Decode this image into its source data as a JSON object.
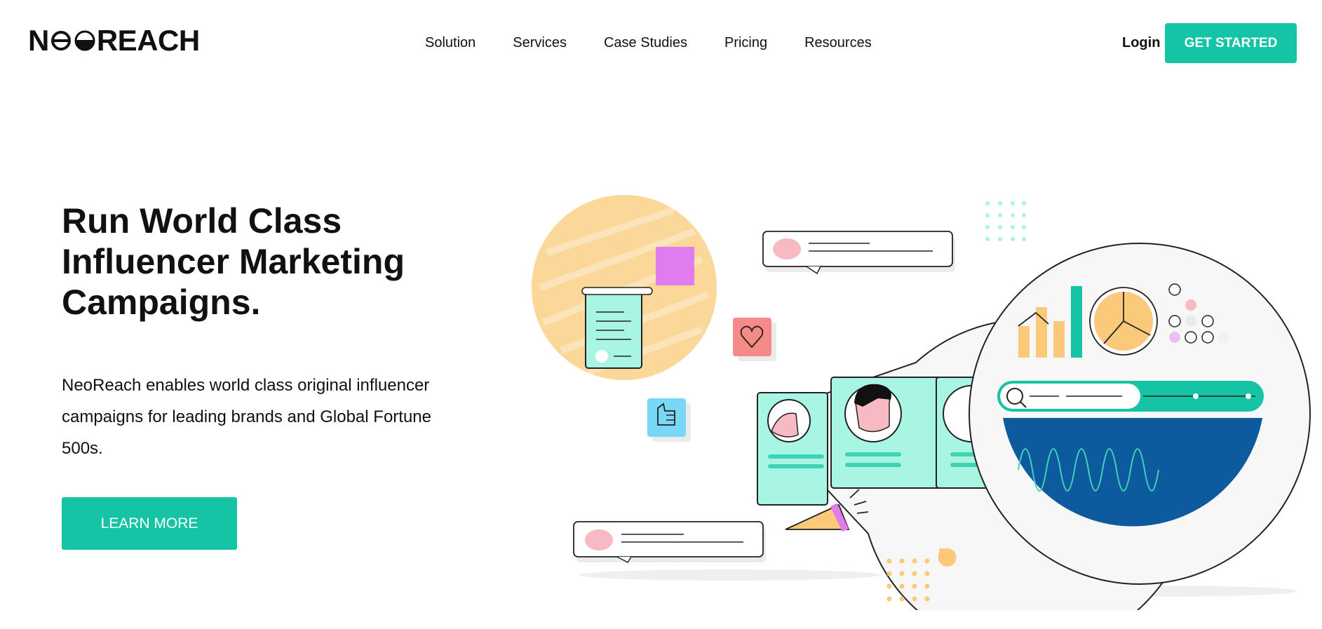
{
  "header": {
    "logo_text_left": "N",
    "logo_text_right": "REACH",
    "logo_alt": "NEOREACH",
    "nav": [
      "Solution",
      "Services",
      "Case Studies",
      "Pricing",
      "Resources"
    ],
    "login_label": "Login",
    "cta_label": "GET STARTED"
  },
  "hero": {
    "title": "Run World Class Influencer Marketing Campaigns.",
    "description": "NeoReach enables world class original influencer campaigns for leading brands and Global Fortune 500s.",
    "cta_label": "LEARN MORE"
  },
  "colors": {
    "accent": "#14c4a4",
    "mint": "#a8f5e3",
    "navy": "#0d5a9e",
    "peach": "#fbc97a",
    "pink": "#f7b9c2",
    "coral": "#f58a86",
    "violet": "#e07cf0",
    "sky": "#7ad8f7"
  },
  "icons": {
    "heart": "heart-icon",
    "thumbs_up": "thumbs-up-icon",
    "search": "search-icon",
    "megaphone": "megaphone-icon",
    "pie_chart": "pie-chart-icon",
    "bar_chart": "bar-chart-icon"
  }
}
